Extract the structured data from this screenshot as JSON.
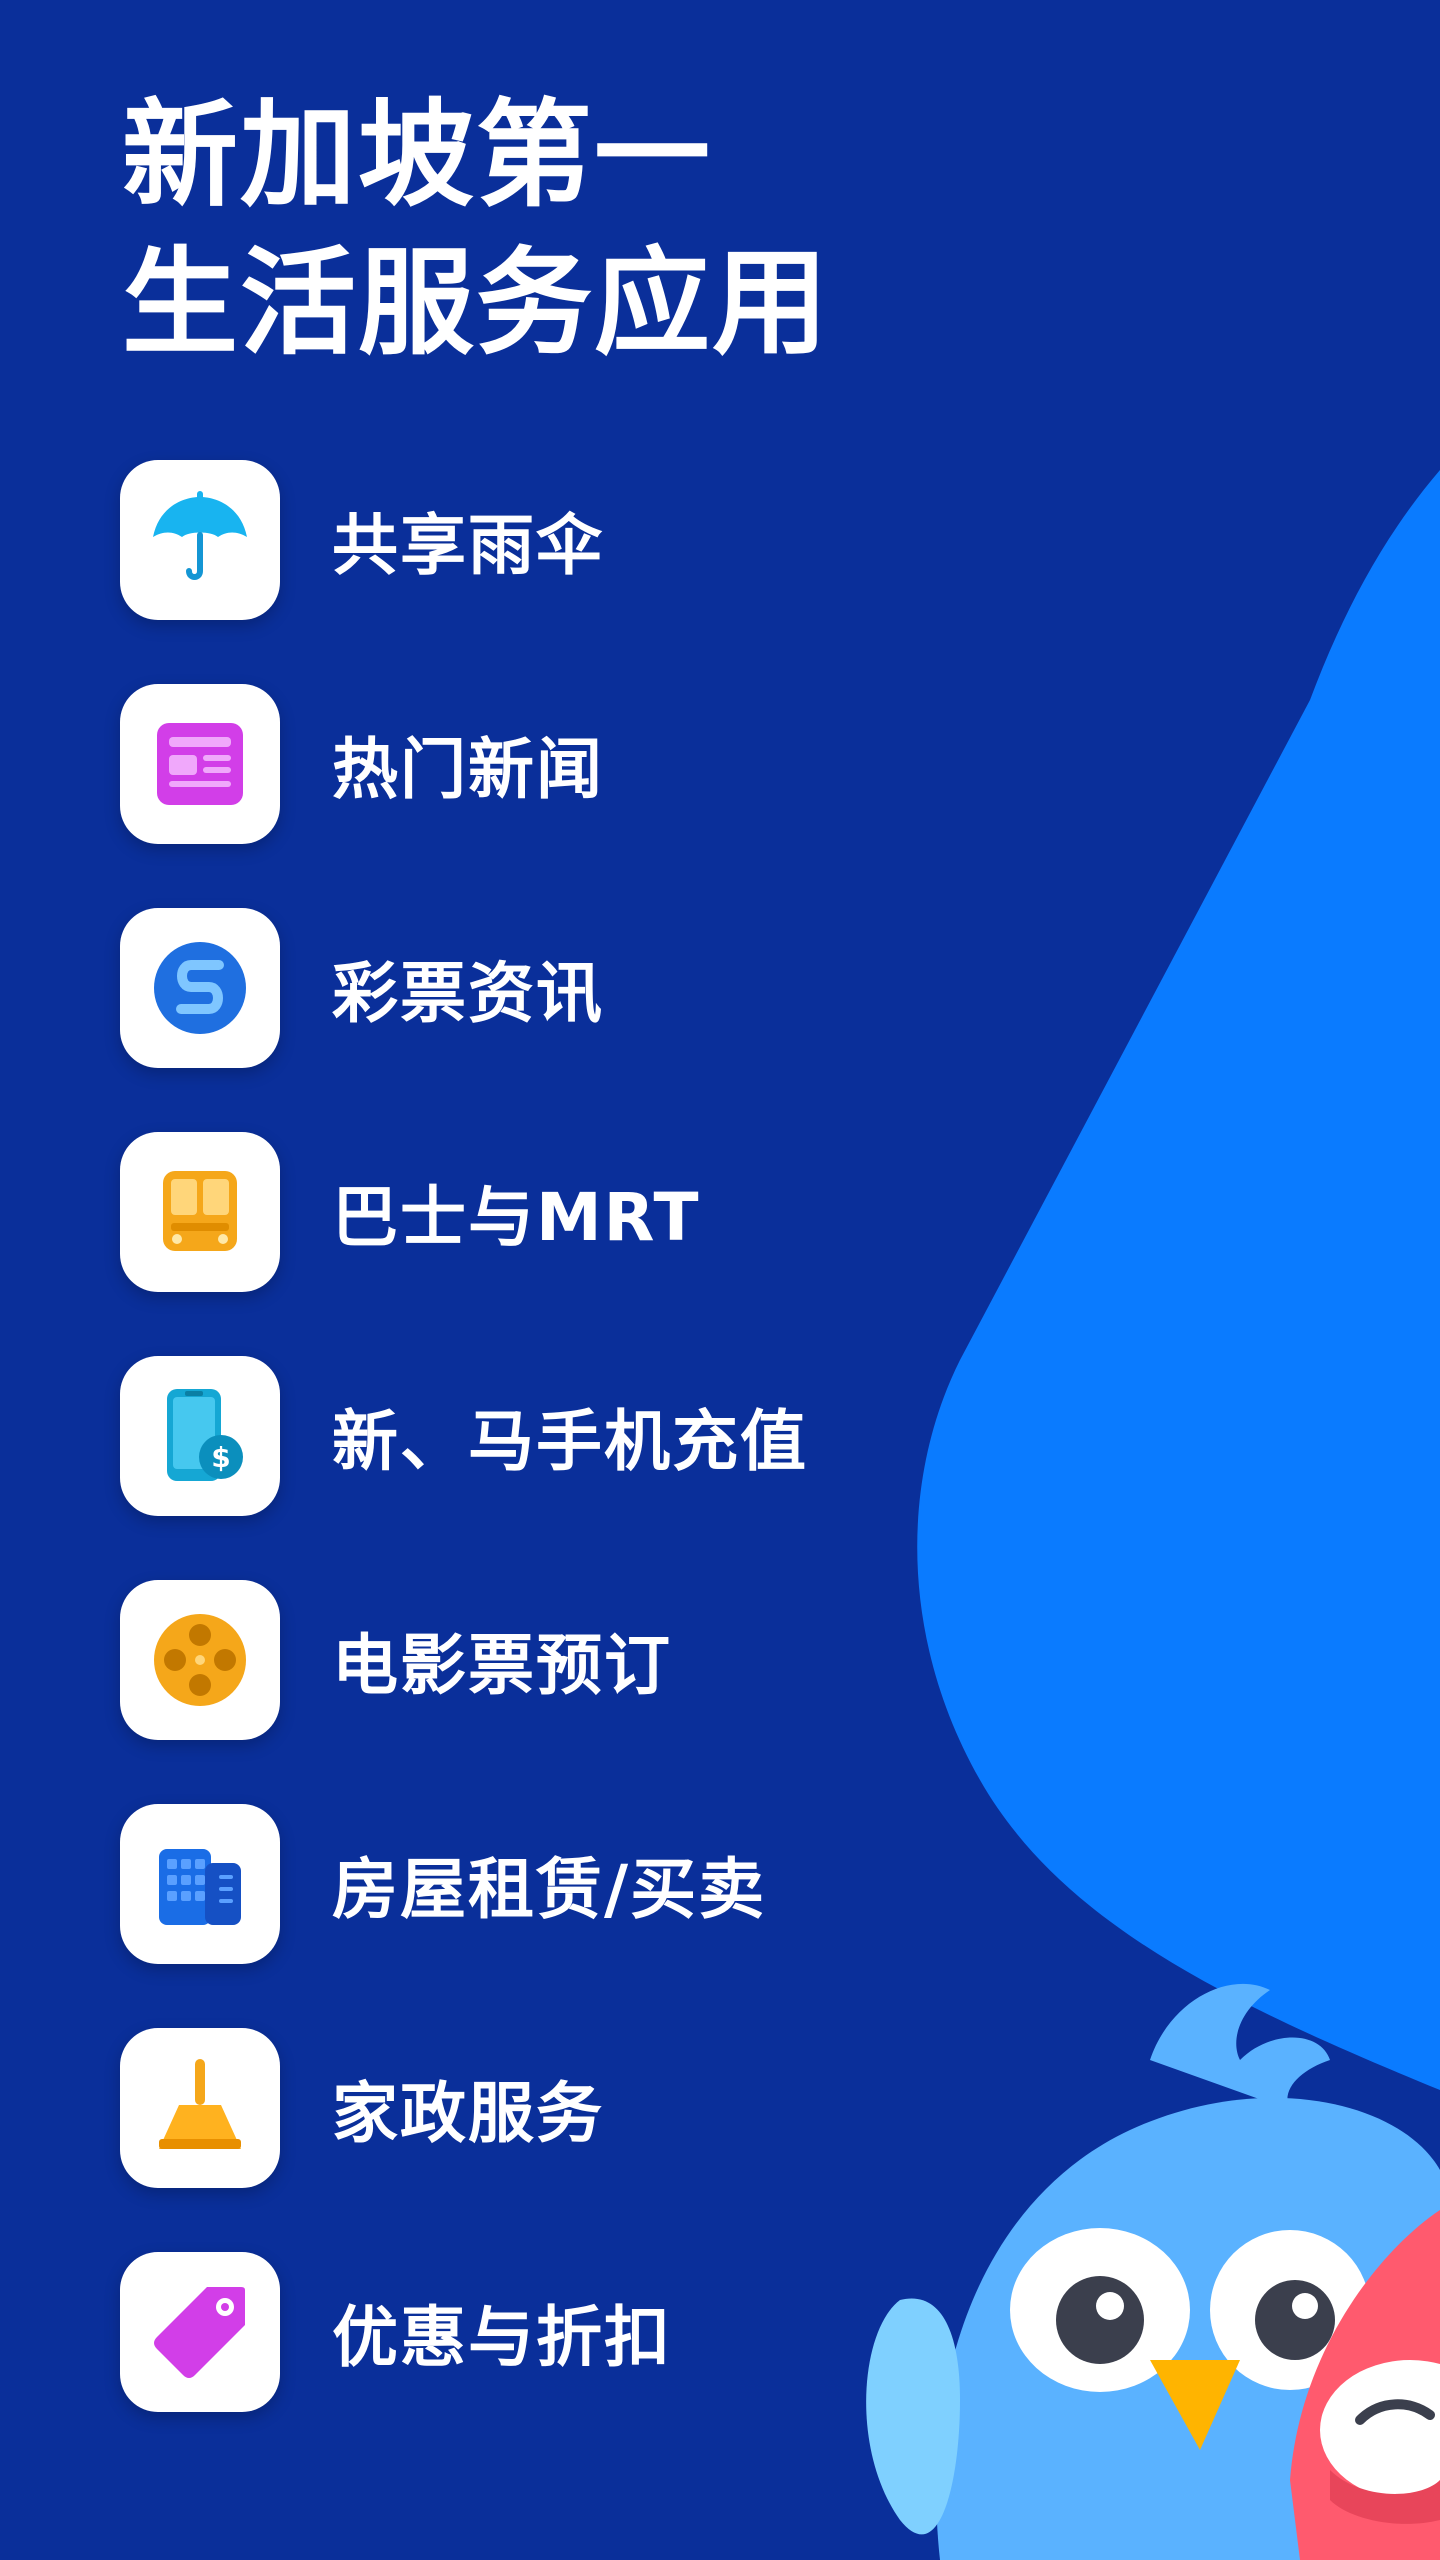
{
  "headline": {
    "line1": "新加坡第一",
    "line2": "生活服务应用"
  },
  "features": [
    {
      "label": "共享雨伞",
      "icon": "umbrella-icon"
    },
    {
      "label": "热门新闻",
      "icon": "newspaper-icon"
    },
    {
      "label": "彩票资讯",
      "icon": "lottery-icon"
    },
    {
      "label": "巴士与MRT",
      "icon": "bus-icon"
    },
    {
      "label": "新、马手机充值",
      "icon": "phone-topup-icon"
    },
    {
      "label": "电影票预订",
      "icon": "film-reel-icon"
    },
    {
      "label": "房屋租赁/买卖",
      "icon": "building-icon"
    },
    {
      "label": "家政服务",
      "icon": "broom-icon"
    },
    {
      "label": "优惠与折扣",
      "icon": "price-tag-icon"
    }
  ],
  "colors": {
    "background": "#0a2f9a",
    "blob": "#0a7bff",
    "tile": "#ffffff",
    "text": "#ffffff"
  }
}
